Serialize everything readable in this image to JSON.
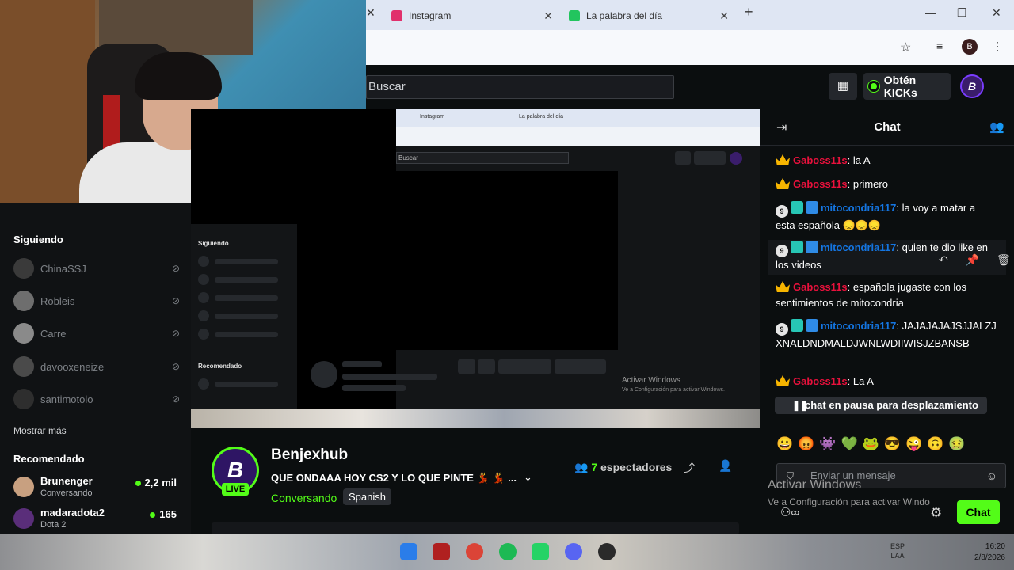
{
  "browser": {
    "tabs": [
      {
        "label": "Instagram",
        "color": "#e1306c"
      },
      {
        "label": "La palabra del día",
        "color": "#22c55e"
      }
    ]
  },
  "header": {
    "search_placeholder": "Buscar",
    "get_kicks_label": "Obtén KICKs",
    "user_initial": "B"
  },
  "sidebar": {
    "following_heading": "Siguiendo",
    "following": [
      {
        "name": "ChinaSSJ"
      },
      {
        "name": "Robleis"
      },
      {
        "name": "Carre"
      },
      {
        "name": "davooxeneize"
      },
      {
        "name": "santimotolo"
      }
    ],
    "show_more": "Mostrar más",
    "recommended_heading": "Recomendado",
    "recommended": [
      {
        "name": "Brunenger",
        "category": "Conversando",
        "viewers": "2,2 mil"
      },
      {
        "name": "madaradota2",
        "category": "Dota 2",
        "viewers": "165"
      }
    ]
  },
  "nested_screen": {
    "tab1": "Instagram",
    "tab2": "La palabra del día",
    "search": "Buscar",
    "following": "Siguiendo",
    "recommended": "Recomendado",
    "watermark_title": "Activar Windows",
    "watermark_sub": "Ve a Configuración para activar Windows."
  },
  "stream": {
    "channel_name": "Benjexhub",
    "avatar_initial": "B",
    "live_label": "LIVE",
    "title": "QUE ONDAAA HOY CS2 Y LO QUE PINTE 💃 💃 ...",
    "category": "Conversando",
    "language": "Spanish",
    "viewer_count": "7",
    "viewer_suffix": "espectadores"
  },
  "chat": {
    "title": "Chat",
    "messages": [
      {
        "user": "Gaboss11s",
        "text": ": la A"
      },
      {
        "user": "Gaboss11s",
        "text": ": primero"
      },
      {
        "user": "mitocondria117",
        "text": ": la voy a matar a esta española 😞😞😞"
      },
      {
        "user": "mitocondria117",
        "text": ": quien te dio like en los videos"
      },
      {
        "user": "Gaboss11s",
        "text": ": española jugaste con los sentimientos de mitocondria"
      },
      {
        "user": "mitocondria117",
        "text": ": JAJAJAJAJSJJALZJXNALDNDMALDJWNLWDIIWISJZBANSB"
      },
      {
        "user": "Gaboss11s",
        "text": ": La A"
      }
    ],
    "badge_initial": "9",
    "paused_label": "chat en pausa para desplazamiento",
    "input_placeholder": "Enviar un mensaje",
    "send_label": "Chat"
  },
  "windows_watermark": {
    "title": "Activar Windows",
    "subtitle": "Ve a Configuración para activar Windo"
  },
  "taskbar": {
    "lang_line1": "ESP",
    "lang_line2": "LAA",
    "time": "16:20",
    "date": "2/8/2026"
  },
  "colors": {
    "kick_green": "#53fc18",
    "chat_red_user": "#e9113c",
    "chat_blue_user": "#1475e1"
  }
}
